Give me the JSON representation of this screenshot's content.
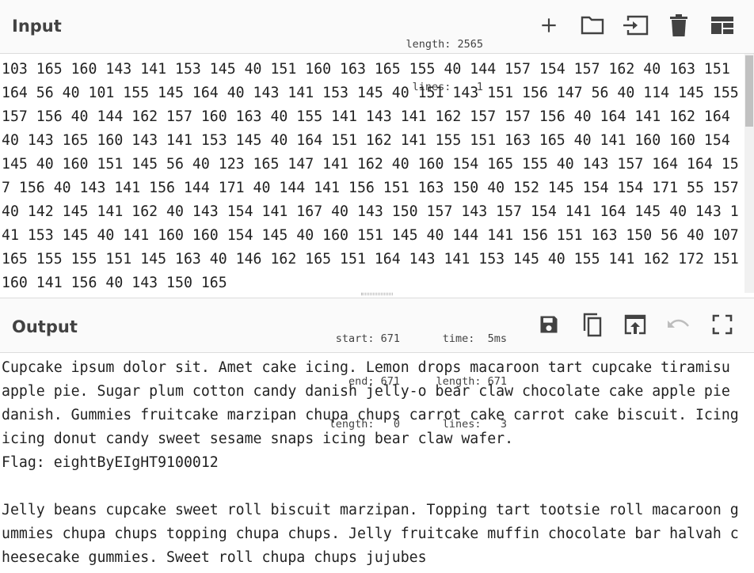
{
  "input": {
    "title": "Input",
    "stats": {
      "length_line": "length: 2565",
      "lines_line": "lines:    1"
    },
    "text": "103 165 160 143 141 153 145 40 151 160 163 165 155 40 144 157 154 157 162 40 163 151 164 56 40 101 155 145 164 40 143 141 153 145 40 151 143 151 156 147 56 40 114 145 155 157 156 40 144 162 157 160 163 40 155 141 143 141 162 157 157 156 40 164 141 162 164 40 143 165 160 143 141 153 145 40 164 151 162 141 155 151 163 165 40 141 160 160 154 145 40 160 151 145 56 40 123 165 147 141 162 40 160 154 165 155 40 143 157 164 164 157 156 40 143 141 156 144 171 40 144 141 156 151 163 150 40 152 145 154 154 171 55 157 40 142 145 141 162 40 143 154 141 167 40 143 150 157 143 157 154 141 164 145 40 143 141 153 145 40 141 160 160 154 145 40 160 151 145 40 144 141 156 151 163 150 56 40 107 165 155 155 151 145 163 40 146 162 165 151 164 143 141 153 145 40 155 141 162 172 151 160 141 156 40 143 150 165"
  },
  "output": {
    "title": "Output",
    "stats": {
      "start_line": "start: 671",
      "end_line": "end: 671",
      "length_line": "length:   0",
      "time_line": "time:  5ms",
      "length2_line": "length: 671",
      "lines_line": "lines:   3"
    },
    "text": "Cupcake ipsum dolor sit. Amet cake icing. Lemon drops macaroon tart cupcake tiramisu apple pie. Sugar plum cotton candy danish jelly-o bear claw chocolate cake apple pie danish. Gummies fruitcake marzipan chupa chups carrot cake carrot cake biscuit. Icing icing donut candy sweet sesame snaps icing bear claw wafer.\nFlag: eightByEIgHT9100012\n\nJelly beans cupcake sweet roll biscuit marzipan. Topping tart tootsie roll macaroon gummies chupa chups topping chupa chups. Jelly fruitcake muffin chocolate bar halvah cheesecake gummies. Sweet roll chupa chups jujubes"
  },
  "icons": {
    "input": [
      "plus-icon",
      "folder-icon",
      "import-icon",
      "trash-icon",
      "layout-icon"
    ],
    "output": [
      "save-icon",
      "copy-icon",
      "replace-input-icon",
      "undo-icon",
      "maximize-icon"
    ]
  },
  "colors": {
    "icon": "#424242",
    "icon_disabled": "#bdbdbd"
  }
}
